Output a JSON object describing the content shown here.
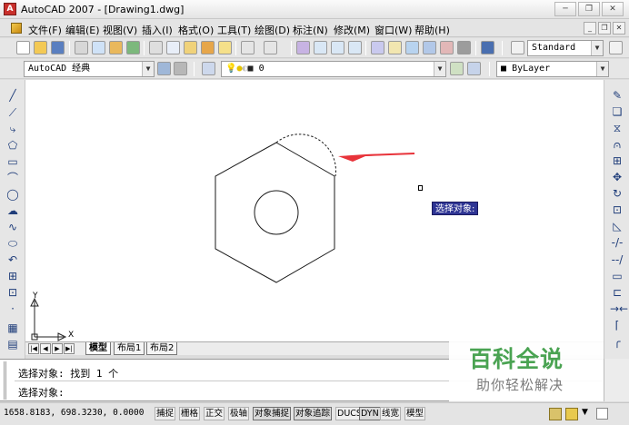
{
  "window": {
    "title": "AutoCAD 2007 - [Drawing1.dwg]",
    "app_icon_glyph": "A",
    "minimize": "─",
    "restore": "❐",
    "close": "✕"
  },
  "menu": {
    "items": [
      "文件(F)",
      "编辑(E)",
      "视图(V)",
      "插入(I)",
      "格式(O)",
      "工具(T)",
      "绘图(D)",
      "标注(N)",
      "修改(M)",
      "窗口(W)",
      "帮助(H)"
    ],
    "mdi_minimize": "_",
    "mdi_restore": "❐",
    "mdi_close": "✕"
  },
  "toolbar": {
    "text_style": "Standard",
    "workspace": "AutoCAD 经典",
    "layer": "0",
    "color": "ByLayer"
  },
  "drawing": {
    "tooltip": "选择对象:",
    "ucs_x": "X",
    "ucs_y": "Y"
  },
  "layout_tabs": {
    "nav": [
      "|◀",
      "◀",
      "▶",
      "▶|"
    ],
    "tabs": [
      "模型",
      "布局1",
      "布局2"
    ]
  },
  "command": {
    "line1": "选择对象: 找到 1 个",
    "line2": "选择对象:"
  },
  "status": {
    "coordinates": "1658.8183,  698.3230,  0.0000",
    "toggles": [
      {
        "label": "捕捉",
        "on": false
      },
      {
        "label": "栅格",
        "on": false
      },
      {
        "label": "正交",
        "on": false
      },
      {
        "label": "极轴",
        "on": false
      },
      {
        "label": "对象捕捉",
        "on": true
      },
      {
        "label": "对象追踪",
        "on": true
      },
      {
        "label": "DUCS",
        "on": false
      },
      {
        "label": "DYN",
        "on": true
      },
      {
        "label": "线宽",
        "on": false
      },
      {
        "label": "模型",
        "on": false
      }
    ]
  },
  "watermark": {
    "brand": "百科全说",
    "tagline": "助你轻松解决"
  },
  "colors": {
    "arrow": "#e8333a",
    "tooltip_bg": "#2f3594",
    "watermark_green": "#4aa352"
  }
}
